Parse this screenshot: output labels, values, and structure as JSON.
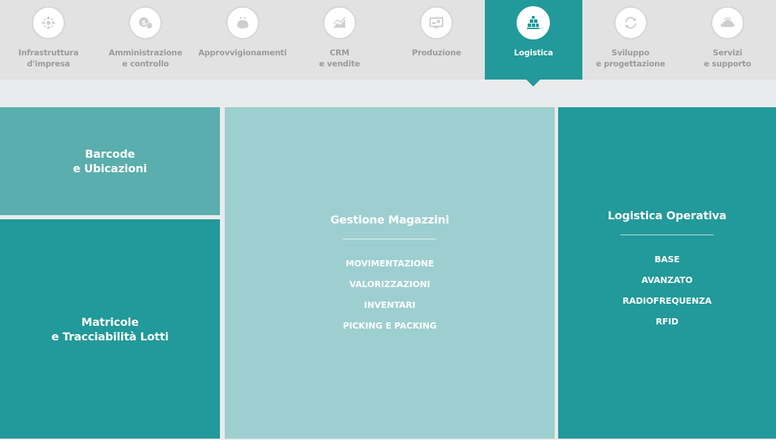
{
  "tabs": [
    {
      "label": "Infrastruttura\nd'impresa",
      "icon": "network-icon",
      "active": false
    },
    {
      "label": "Amministrazione\ne controllo",
      "icon": "coins-icon",
      "active": false
    },
    {
      "label": "Approvvigionamenti",
      "icon": "purse-icon",
      "active": false
    },
    {
      "label": "CRM\ne vendite",
      "icon": "chart-icon",
      "active": false
    },
    {
      "label": "Produzione",
      "icon": "monitor-gear-icon",
      "active": false
    },
    {
      "label": "Logistica",
      "icon": "warehouse-icon",
      "active": true
    },
    {
      "label": "Sviluppo\ne progettazione",
      "icon": "refresh-icon",
      "active": false
    },
    {
      "label": "Servizi\ne supporto",
      "icon": "cloud-wifi-icon",
      "active": false
    }
  ],
  "panels": {
    "barcode": {
      "title": "Barcode\ne Ubicazioni"
    },
    "matricole": {
      "title": "Matricole\ne Tracciabilità Lotti"
    },
    "magazzini": {
      "title": "Gestione Magazzini",
      "items": [
        "MOVIMENTAZIONE",
        "VALORIZZAZIONI",
        "INVENTARI",
        "PICKING E PACKING"
      ]
    },
    "logistica": {
      "title": "Logistica Operativa",
      "items": [
        "BASE",
        "AVANZATO",
        "RADIOFREQUENZA",
        "RFID"
      ]
    }
  },
  "colors": {
    "accent": "#22999a",
    "light_teal": "#5aaeae",
    "pale_teal": "#9dcfd0",
    "tab_bg": "#e2e2e2",
    "inactive_icon": "#cfcfcf"
  }
}
